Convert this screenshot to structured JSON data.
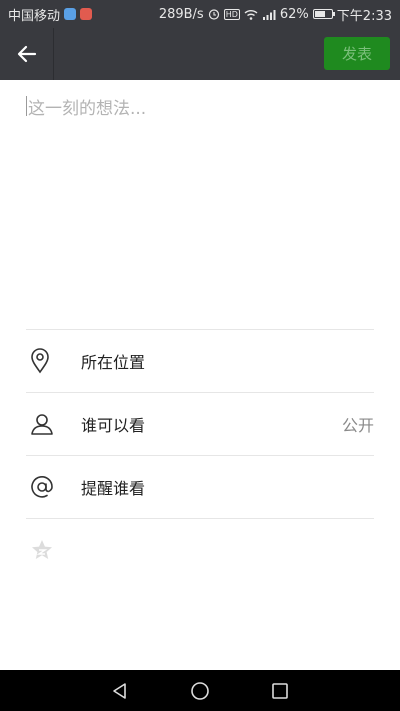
{
  "status_bar": {
    "carrier": "中国移动",
    "net_speed": "289B/s",
    "hd": "HD",
    "signal": "4G",
    "battery_percent": "62%",
    "battery_level": 0.62,
    "time": "下午2:33"
  },
  "app_bar": {
    "back_icon": "arrow-left-icon",
    "publish_label": "发表"
  },
  "composer": {
    "placeholder": "这一刻的想法..."
  },
  "options": [
    {
      "icon": "location-pin-icon",
      "label": "所在位置",
      "value": ""
    },
    {
      "icon": "person-icon",
      "label": "谁可以看",
      "value": "公开"
    },
    {
      "icon": "at-icon",
      "label": "提醒谁看",
      "value": ""
    }
  ],
  "extra_icon": "star-icon",
  "colors": {
    "bar_bg": "#393a3f",
    "publish_bg": "#1f8a1f",
    "publish_text": "#7bbf7b"
  }
}
